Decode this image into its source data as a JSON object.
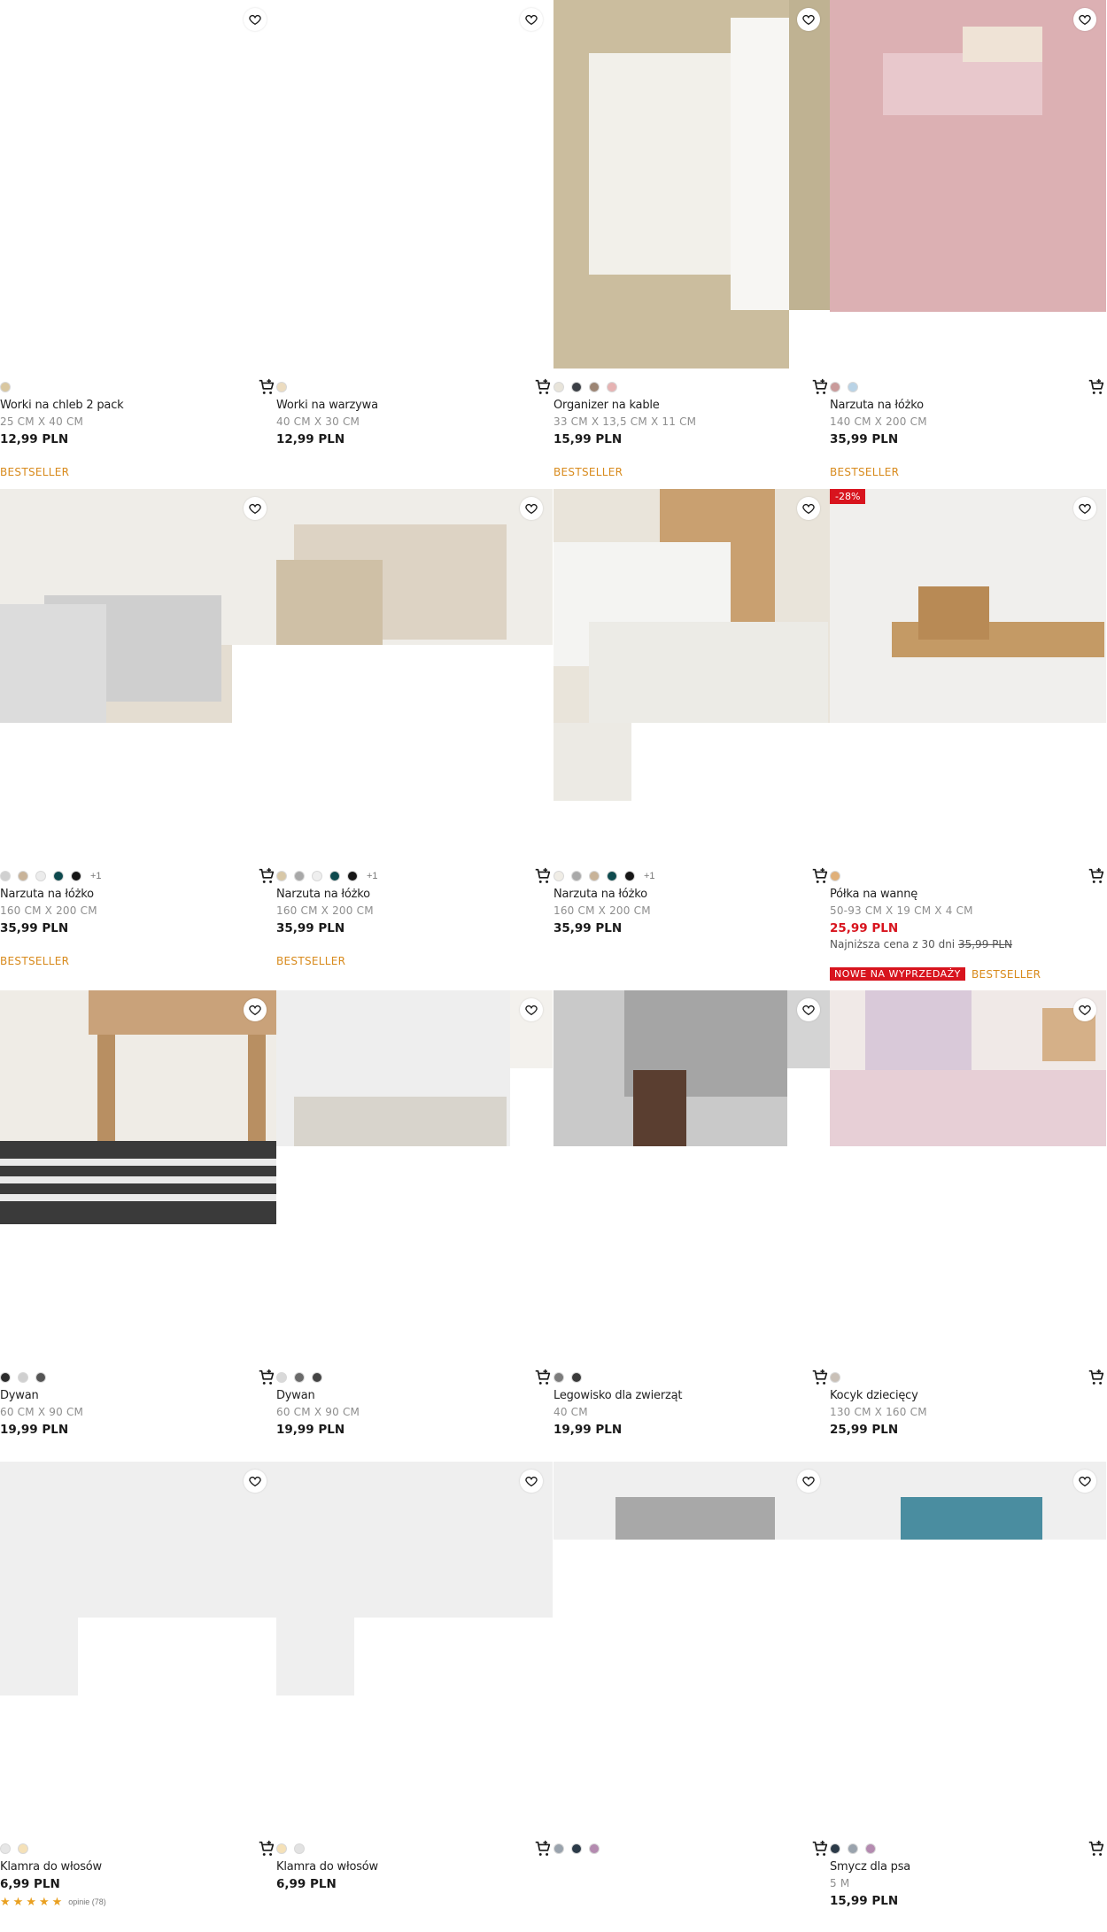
{
  "products": [
    {
      "name": "Worki na chleb 2 pack",
      "dim": "25 CM X 40 CM",
      "price": "12,99 PLN",
      "badge": "BESTSELLER",
      "swatches": [
        "#d9c7a0"
      ]
    },
    {
      "name": "Worki na warzywa",
      "dim": "40 CM X 30 CM",
      "price": "12,99 PLN",
      "swatches": [
        "#ecdcc0"
      ]
    },
    {
      "name": "Organizer na kable",
      "dim": "33 CM X 13,5 CM X 11 CM",
      "price": "15,99 PLN",
      "badge": "BESTSELLER",
      "swatches": [
        "#e8e4da",
        "#3b3f45",
        "#9c8574",
        "#e6b3b3"
      ]
    },
    {
      "name": "Narzuta na łóżko",
      "dim": "140 CM X 200 CM",
      "price": "35,99 PLN",
      "badge": "BESTSELLER",
      "swatches": [
        "#c99a9a",
        "#b9d3e6"
      ]
    },
    {
      "name": "Narzuta na łóżko",
      "dim": "160 CM X 200 CM",
      "price": "35,99 PLN",
      "badge": "BESTSELLER",
      "swatches": [
        "#d0d0d0",
        "#c8b399",
        "#ececec",
        "#0e4a4e",
        "#161616"
      ],
      "more": "+1"
    },
    {
      "name": "Narzuta na łóżko",
      "dim": "160 CM X 200 CM",
      "price": "35,99 PLN",
      "badge": "BESTSELLER",
      "swatches": [
        "#d8c8a8",
        "#a8a8a8",
        "#efefef",
        "#0e4a4e",
        "#161616"
      ],
      "more": "+1"
    },
    {
      "name": "Narzuta na łóżko",
      "dim": "160 CM X 200 CM",
      "price": "35,99 PLN",
      "swatches": [
        "#f0ede6",
        "#a9a9a9",
        "#c8b399",
        "#0e4a4e",
        "#161616"
      ],
      "more": "+1"
    },
    {
      "name": "Półka na wannę",
      "dim": "50-93 CM X 19 CM X 4 CM",
      "price": "25,99 PLN",
      "lowest_label": "Najniższa cena z 30 dni",
      "lowest_price": "35,99 PLN",
      "discount": "-28%",
      "badge_sale": "NOWE NA WYPRZEDAŻY",
      "badge": "BESTSELLER",
      "swatches": [
        "#e0b07a"
      ]
    },
    {
      "name": "Dywan",
      "dim": "60 CM X 90 CM",
      "price": "19,99 PLN",
      "swatches": [
        "#2c2c2c",
        "#d0d0d0",
        "#555555"
      ]
    },
    {
      "name": "Dywan",
      "dim": "60 CM X 90 CM",
      "price": "19,99 PLN",
      "swatches": [
        "#d9d9d9",
        "#6a6a6a",
        "#444444"
      ]
    },
    {
      "name": "Legowisko dla zwierząt",
      "dim": "40 CM",
      "price": "19,99 PLN",
      "swatches": [
        "#7c7c7c",
        "#3a3a3a"
      ]
    },
    {
      "name": "Kocyk dziecięcy",
      "dim": "130 CM X 160 CM",
      "price": "25,99 PLN",
      "swatches": [
        "#c9c0b7"
      ]
    },
    {
      "name": "Klamra do włosów",
      "price": "6,99 PLN",
      "rating_text": "opinie (78)",
      "swatches": [
        "#e6e6e6",
        "#f5e1b8"
      ]
    },
    {
      "name": "Klamra do włosów",
      "price": "6,99 PLN",
      "swatches": [
        "#f5e1b8",
        "#e2e2e2"
      ]
    },
    {
      "name": "",
      "price": "",
      "swatches": [
        "#9aa3ad",
        "#2b3a48",
        "#b48bb0"
      ]
    },
    {
      "name": "Smycz dla psa",
      "dim": "5 M",
      "price": "15,99 PLN",
      "swatches": [
        "#2b3a48",
        "#9aa3ad",
        "#b48bb0"
      ]
    }
  ],
  "icons": {
    "fav": "heart-icon",
    "cart": "add-to-cart-icon",
    "star": "star-icon"
  }
}
